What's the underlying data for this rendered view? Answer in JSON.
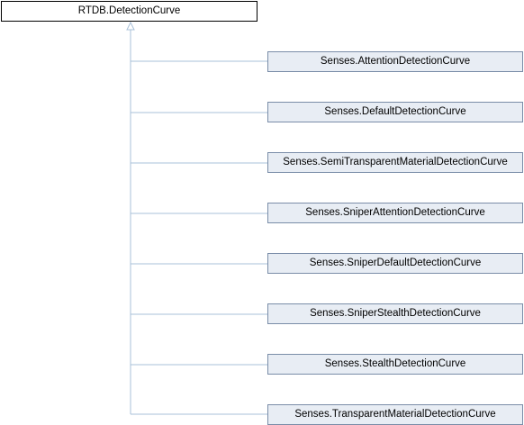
{
  "diagram": {
    "base_class": "RTDB.DetectionCurve",
    "derived_classes": [
      "Senses.AttentionDetectionCurve",
      "Senses.DefaultDetectionCurve",
      "Senses.SemiTransparentMaterialDetectionCurve",
      "Senses.SniperAttentionDetectionCurve",
      "Senses.SniperDefaultDetectionCurve",
      "Senses.SniperStealthDetectionCurve",
      "Senses.StealthDetectionCurve",
      "Senses.TransparentMaterialDetectionCurve"
    ],
    "colors": {
      "child_fill": "#e8edf4",
      "child_border": "#7a8da8",
      "connector": "#a8c0d8"
    }
  }
}
